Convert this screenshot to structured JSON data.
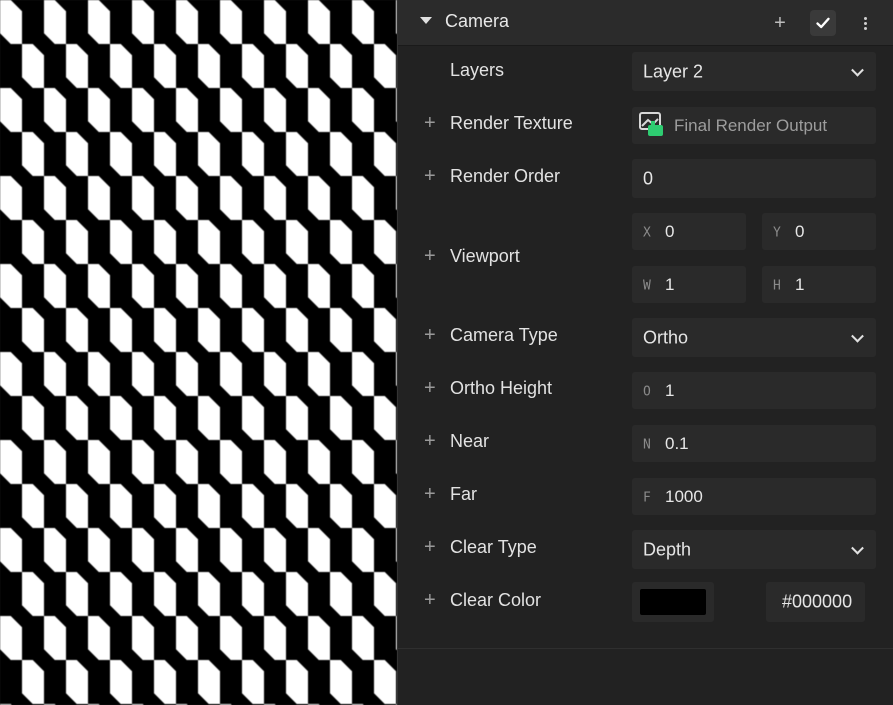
{
  "camera_panel": {
    "title": "Camera",
    "layers": {
      "label": "Layers",
      "value": "Layer 2"
    },
    "render_texture": {
      "label": "Render Texture",
      "value": "Final Render Output"
    },
    "render_order": {
      "label": "Render Order",
      "value": "0"
    },
    "viewport": {
      "label": "Viewport",
      "x": {
        "prefix": "X",
        "value": "0"
      },
      "y": {
        "prefix": "Y",
        "value": "0"
      },
      "w": {
        "prefix": "W",
        "value": "1"
      },
      "h": {
        "prefix": "H",
        "value": "1"
      }
    },
    "camera_type": {
      "label": "Camera Type",
      "value": "Ortho"
    },
    "ortho_height": {
      "label": "Ortho Height",
      "prefix": "O",
      "value": "1"
    },
    "near": {
      "label": "Near",
      "prefix": "N",
      "value": "0.1"
    },
    "far": {
      "label": "Far",
      "prefix": "F",
      "value": "1000"
    },
    "clear_type": {
      "label": "Clear Type",
      "value": "Depth"
    },
    "clear_color": {
      "label": "Clear Color",
      "hex": "#000000",
      "swatch_color": "#000000"
    }
  },
  "icons": {
    "header_add": "plus-icon",
    "header_toggle": "checkmark-icon",
    "header_more": "more-vertical-icon",
    "collapse": "caret-down-icon",
    "texture": "render-texture-icon",
    "row_add": "plus-icon",
    "dropdown": "chevron-down-icon"
  },
  "colors": {
    "panel_bg": "#222222",
    "field_bg": "#2a2a2a",
    "texture_icon_accent": "#2ecc71"
  }
}
